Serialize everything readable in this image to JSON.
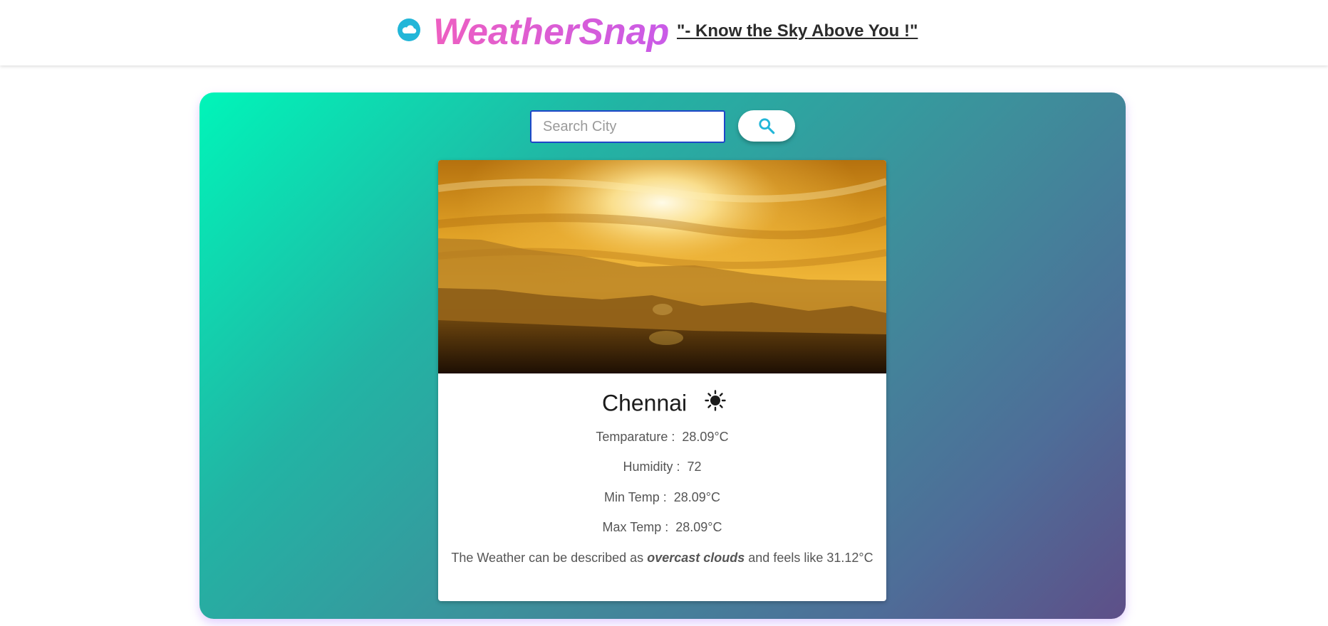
{
  "header": {
    "brand_name": "WeatherSnap",
    "brand_icon": "cloud-icon",
    "tagline": "\"- Know the Sky Above You !\""
  },
  "search": {
    "placeholder": "Search City",
    "value": "",
    "button_icon": "search-icon"
  },
  "weather": {
    "city": "Chennai",
    "condition_icon": "sun-icon",
    "temperature_label": "Temparature :",
    "temperature_value": "28.09°C",
    "humidity_label": "Humidity :",
    "humidity_value": "72",
    "min_temp_label": "Min Temp :",
    "min_temp_value": "28.09°C",
    "max_temp_label": "Max Temp :",
    "max_temp_value": "28.09°C",
    "description_prefix": "The Weather can be described as",
    "description": "overcast clouds",
    "feels_like_prefix": "and feels like",
    "feels_like_value": "31.12°C"
  },
  "colors": {
    "brand_gradient_start": "#ee5fc1",
    "brand_gradient_end": "#c95be8",
    "brand_icon": "#22b6d8",
    "panel_gradient_start": "#00f5b9",
    "panel_gradient_end": "#5e4f88",
    "search_border": "#1e46c8"
  }
}
